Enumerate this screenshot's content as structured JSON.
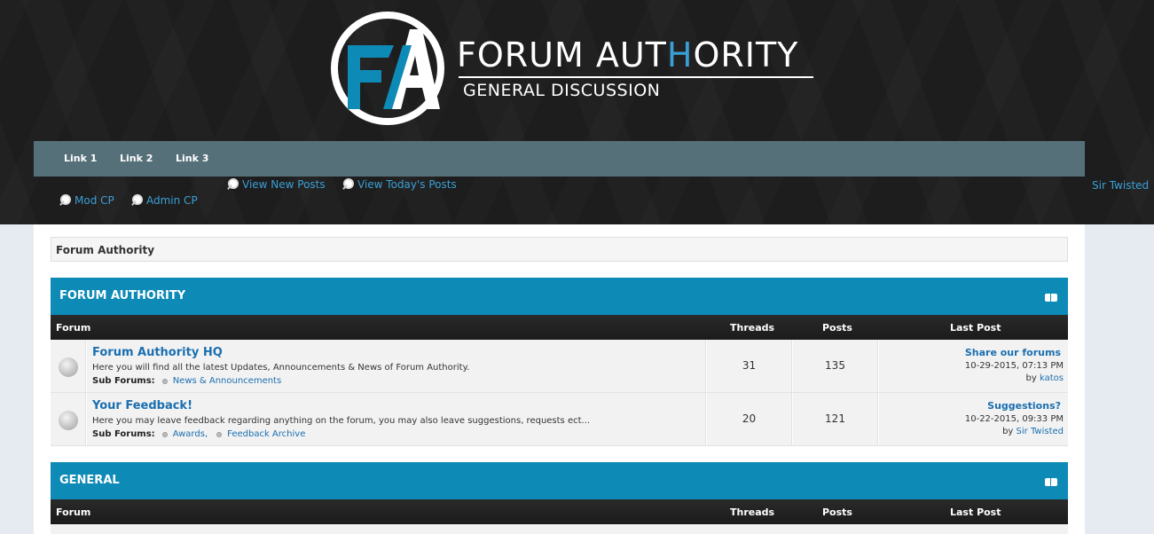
{
  "header": {
    "logo_monogram": "FA",
    "site_name_part1": "FORUM AUT",
    "site_name_accent": "H",
    "site_name_part2": "ORITY",
    "site_subtitle": "GENERAL DISCUSSION"
  },
  "navbar": {
    "links": [
      "Link 1",
      "Link 2",
      "Link 3"
    ]
  },
  "quick_links": {
    "view_new_posts": "View New Posts",
    "view_todays_posts": "View Today's Posts",
    "mod_cp": "Mod CP",
    "admin_cp": "Admin CP"
  },
  "user": {
    "name": "Sir Twisted"
  },
  "breadcrumb": {
    "label": "Forum Authority"
  },
  "columns": {
    "forum": "Forum",
    "threads": "Threads",
    "posts": "Posts",
    "last_post": "Last Post"
  },
  "categories": [
    {
      "title": "FORUM AUTHORITY",
      "forums": [
        {
          "title": "Forum Authority HQ",
          "description": "Here you will find all the latest Updates, Announcements & News of Forum Authority.",
          "sub_forums_label": "Sub Forums:",
          "sub_forums": [
            "News & Announcements"
          ],
          "threads": "31",
          "posts": "135",
          "last_post_title": "Share our forums",
          "last_post_date": "10-29-2015, 07:13 PM",
          "last_post_by_prefix": "by",
          "last_post_user": "katos"
        },
        {
          "title": "Your Feedback!",
          "description": "Here you may leave feedback regarding anything on the forum, you may also leave suggestions, requests ect...",
          "sub_forums_label": "Sub Forums:",
          "sub_forums": [
            "Awards",
            "Feedback Archive"
          ],
          "sub_forum_separator": ",",
          "threads": "20",
          "posts": "121",
          "last_post_title": "Suggestions?",
          "last_post_date": "10-22-2015, 09:33 PM",
          "last_post_by_prefix": "by",
          "last_post_user": "Sir Twisted"
        }
      ]
    },
    {
      "title": "GENERAL"
    }
  ],
  "colors": {
    "header_bg": "#1d1d1d",
    "navbar_bg": "#56707a",
    "category_bg": "#0e8ab6",
    "link": "#1a6fb0",
    "accent": "#3a9fd6"
  }
}
